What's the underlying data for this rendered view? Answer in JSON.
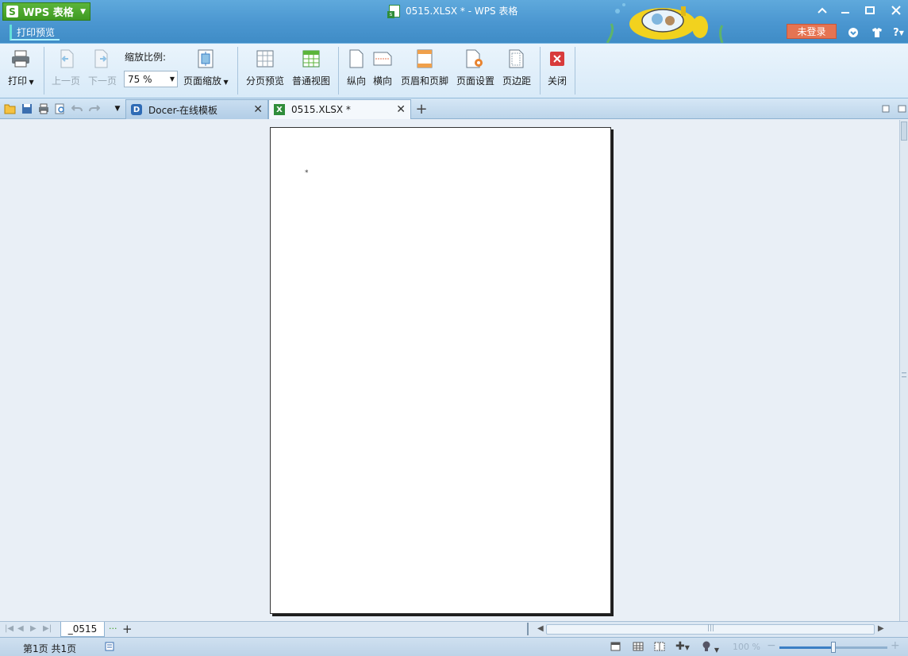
{
  "app": {
    "menu_label": "WPS 表格",
    "logo_letter": "S",
    "mode_tab": "打印预览",
    "window_title": "0515.XLSX * - WPS 表格",
    "login_label": "未登录"
  },
  "ribbon": {
    "print_label": "打印",
    "prev_page_label": "上一页",
    "next_page_label": "下一页",
    "zoom_ratio_label": "缩放比例:",
    "zoom_value": "75 %",
    "page_zoom_label": "页面缩放",
    "page_break_preview_label": "分页预览",
    "normal_view_label": "普通视图",
    "portrait_label": "纵向",
    "landscape_label": "横向",
    "header_footer_label": "页眉和页脚",
    "page_setup_label": "页面设置",
    "margins_label": "页边距",
    "close_label": "关闭"
  },
  "tabs": [
    {
      "label": "Docer-在线模板",
      "active": false
    },
    {
      "label": "0515.XLSX *",
      "active": true
    }
  ],
  "page": {
    "mark": "*"
  },
  "sheets": {
    "tab_label": "_0515"
  },
  "status": {
    "page_info": "第1页 共1页",
    "zoom_percent": "100 %",
    "zoom_fraction": 0.5
  },
  "colors": {
    "title_bar": "#4a96d0",
    "app_menu": "#3f9a22",
    "login": "#e57452",
    "close_red": "#d83b3b"
  }
}
